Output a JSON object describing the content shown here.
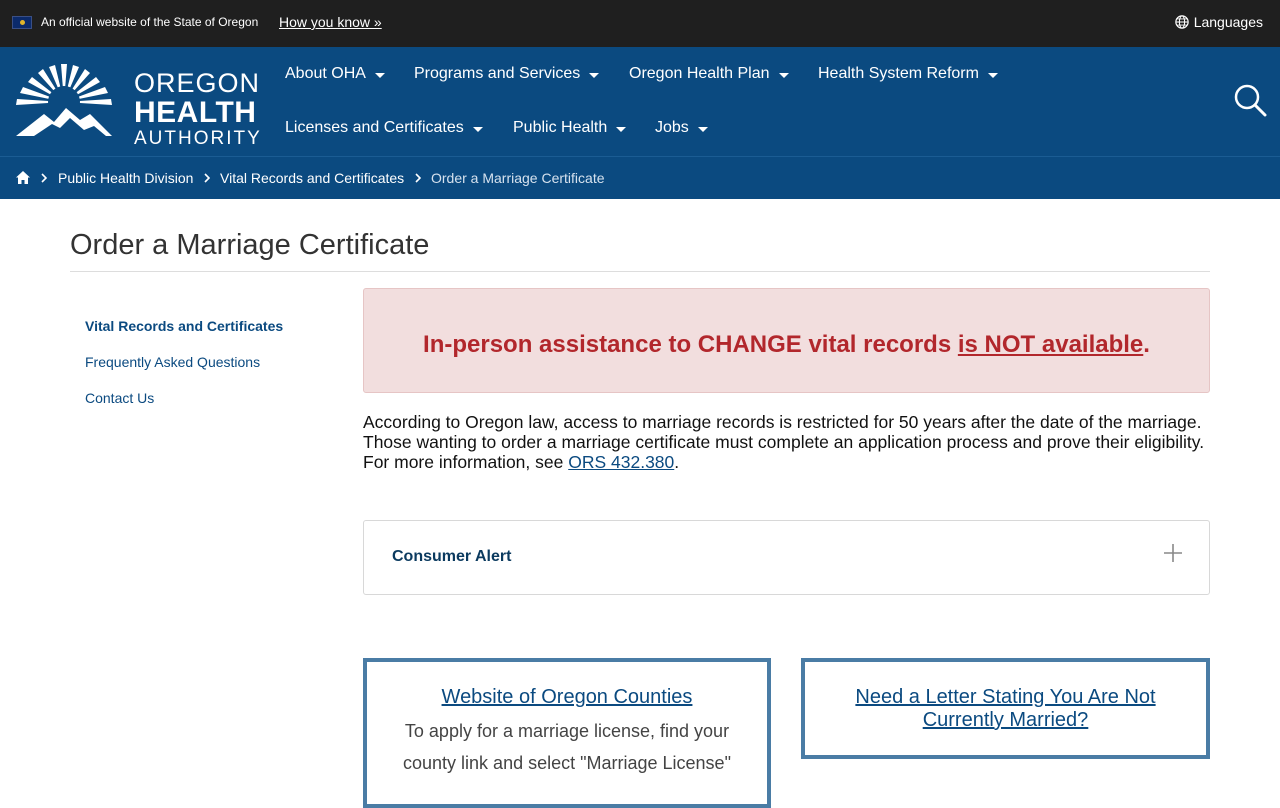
{
  "official_bar": {
    "text": "An official website of the State of Oregon",
    "how_link": "How you know »",
    "languages": "Languages"
  },
  "logo": {
    "line1": "OREGON",
    "line2": "HEALTH",
    "line3": "AUTHORITY"
  },
  "nav": {
    "items": [
      {
        "label": "About OHA"
      },
      {
        "label": "Programs and Services"
      },
      {
        "label": "Oregon Health Plan"
      },
      {
        "label": "Health System Reform"
      },
      {
        "label": "Licenses and Certificates"
      },
      {
        "label": "Public Health"
      },
      {
        "label": "Jobs"
      }
    ]
  },
  "breadcrumb": {
    "items": [
      "Public Health Division",
      "Vital Records and Certificates"
    ],
    "current": "Order a Marriage Certificate"
  },
  "page": {
    "title": "Order a Marriage Certificate"
  },
  "sidebar": {
    "items": [
      {
        "label": "Vital Records and Certificates"
      },
      {
        "label": "Frequently Asked Questions"
      },
      {
        "label": "Contact Us"
      }
    ]
  },
  "alert": {
    "text_before": "In-person assistance to CHANGE vital records ",
    "text_underlined": "is NOT available",
    "text_after": "."
  },
  "body": {
    "text": "According to Oregon law, access to marriage records is restricted for 50 years after the date of the marriage. Those wanting to order a marriage certificate must complete an application process and prove their eligibility. For more information, see ",
    "link": "ORS 432.380",
    "end": "."
  },
  "accordion": {
    "title": "Consumer Alert"
  },
  "cards": [
    {
      "link": "Website of Oregon Counties",
      "desc": "To apply for a marriage license, find your county link and select \"Marriage License\""
    },
    {
      "link": "Need a Letter Stating You Are Not Currently Married?"
    }
  ],
  "colors": {
    "header_blue": "#0b4a80",
    "alert_bg": "#f2dede",
    "alert_text": "#b2272c",
    "card_border": "#4a7ca5",
    "top_bar": "#1f1f1f"
  }
}
